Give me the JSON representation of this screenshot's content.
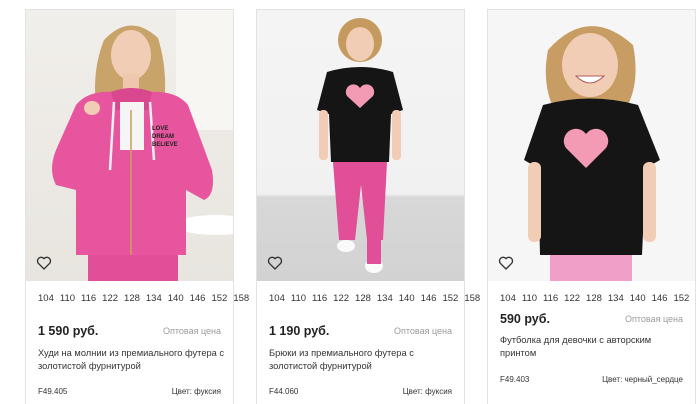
{
  "colors": {
    "fuchsia": "#e8559f",
    "black": "#151515",
    "border": "#e2e2e2",
    "muted": "#9b9b9b"
  },
  "products": [
    {
      "sizes": [
        "104",
        "110",
        "116",
        "122",
        "128",
        "134",
        "140",
        "146",
        "152",
        "158"
      ],
      "price": "1 590 руб.",
      "wholesale_label": "Оптовая цена",
      "title": "Худи на молнии из премиального футера с золотистой фурнитурой",
      "sku": "F49.405",
      "color": "Цвет: фуксия",
      "print_text": "LOVE DREAM BELIEVE",
      "favorite_icon": "heart-icon"
    },
    {
      "sizes": [
        "104",
        "110",
        "116",
        "122",
        "128",
        "134",
        "140",
        "146",
        "152",
        "158"
      ],
      "price": "1 190 руб.",
      "wholesale_label": "Оптовая цена",
      "title": "Брюки из премиального футера с золотистой фурнитурой",
      "sku": "F44.060",
      "color": "Цвет: фуксия",
      "favorite_icon": "heart-icon"
    },
    {
      "sizes": [
        "104",
        "110",
        "116",
        "122",
        "128",
        "134",
        "140",
        "146",
        "152"
      ],
      "price": "590 руб.",
      "wholesale_label": "Оптовая цена",
      "title": "Футболка для девочки с авторским принтом",
      "sku": "F49.403",
      "color": "Цвет: черный_сердце",
      "favorite_icon": "heart-icon"
    }
  ]
}
